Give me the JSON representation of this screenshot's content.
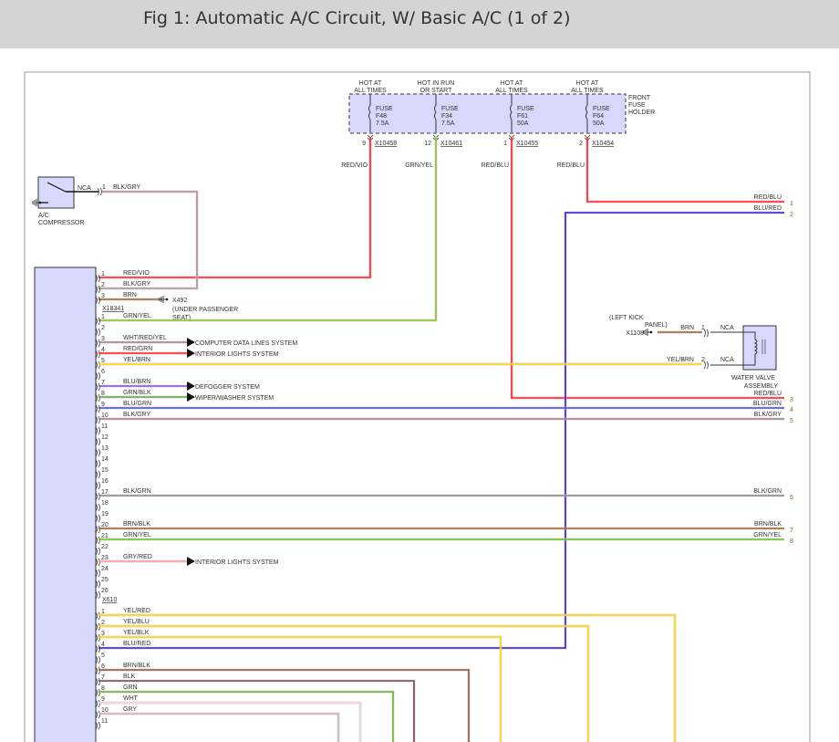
{
  "title": "Fig 1: Automatic A/C Circuit, W/ Basic A/C (1 of 2)",
  "fuse_holder": {
    "label": [
      "FRONT",
      "FUSE",
      "HOLDER"
    ],
    "fuses": [
      {
        "supply": [
          "HOT AT",
          "ALL TIMES"
        ],
        "name": "FUSE",
        "id": "F48",
        "rating": "7.5A",
        "pin": "9",
        "connector": "X10458",
        "wire": "RED/VIO"
      },
      {
        "supply": [
          "HOT IN RUN",
          "OR START"
        ],
        "name": "FUSE",
        "id": "F34",
        "rating": "7.5A",
        "pin": "12",
        "connector": "X10461",
        "wire": "GRN/YEL"
      },
      {
        "supply": [
          "HOT AT",
          "ALL TIMES"
        ],
        "name": "FUSE",
        "id": "F61",
        "rating": "50A",
        "pin": "1",
        "connector": "X10455",
        "wire": "RED/BLU"
      },
      {
        "supply": [
          "HOT AT",
          "ALL TIMES"
        ],
        "name": "FUSE",
        "id": "F64",
        "rating": "50A",
        "pin": "2",
        "connector": "X10454",
        "wire": "RED/BLU"
      }
    ]
  },
  "compressor": {
    "label": [
      "A/C",
      "COMPRESSOR"
    ],
    "nca": "NCA",
    "pin": "1",
    "wire": "BLK/GRY"
  },
  "ground_x492": {
    "id": "X492",
    "location": [
      "(UNDER PASSENGER",
      "SEAT)"
    ]
  },
  "connector_x18341": {
    "label": "X18341",
    "pins": [
      {
        "pin": "1",
        "wire": "RED/VIO",
        "color": "#ff2020"
      },
      {
        "pin": "2",
        "wire": "BLK/GRY",
        "color": "#9a9a9a"
      },
      {
        "pin": "3",
        "wire": "BRN",
        "color": "#8b6a2a"
      }
    ]
  },
  "connector_main": {
    "pins": [
      {
        "pin": "1",
        "wire": "GRN/YEL",
        "color": "#66cc33"
      },
      {
        "pin": "2",
        "wire": "",
        "color": ""
      },
      {
        "pin": "3",
        "wire": "WHT/RED/YEL",
        "color": "#8a8a8a",
        "dest": "COMPUTER DATA LINES SYSTEM"
      },
      {
        "pin": "4",
        "wire": "RED/GRN",
        "color": "#ff2020",
        "dest": "INTERIOR LIGHTS SYSTEM"
      },
      {
        "pin": "5",
        "wire": "YEL/BRN",
        "color": "#f0e000"
      },
      {
        "pin": "6",
        "wire": "",
        "color": ""
      },
      {
        "pin": "7",
        "wire": "BLU/BRN",
        "color": "#6b5bd6",
        "dest": "DEFOGGER SYSTEM"
      },
      {
        "pin": "8",
        "wire": "GRN/BLK",
        "color": "#55aa44",
        "dest": "WIPER/WASHER SYSTEM"
      },
      {
        "pin": "9",
        "wire": "BLU/GRN",
        "color": "#3355cc"
      },
      {
        "pin": "10",
        "wire": "BLK/GRY",
        "color": "#888888"
      },
      {
        "pin": "11",
        "wire": "",
        "color": ""
      },
      {
        "pin": "12",
        "wire": "",
        "color": ""
      },
      {
        "pin": "13",
        "wire": "",
        "color": ""
      },
      {
        "pin": "14",
        "wire": "",
        "color": ""
      },
      {
        "pin": "15",
        "wire": "",
        "color": ""
      },
      {
        "pin": "16",
        "wire": "",
        "color": ""
      },
      {
        "pin": "17",
        "wire": "BLK/GRN",
        "color": "#7f8f7f"
      },
      {
        "pin": "18",
        "wire": "",
        "color": ""
      },
      {
        "pin": "19",
        "wire": "",
        "color": ""
      },
      {
        "pin": "20",
        "wire": "BRN/BLK",
        "color": "#8b6a2a"
      },
      {
        "pin": "21",
        "wire": "GRN/YEL",
        "color": "#55cc22"
      },
      {
        "pin": "22",
        "wire": "",
        "color": ""
      },
      {
        "pin": "23",
        "wire": "GRY/RED",
        "color": "#f0a0a8",
        "dest": "INTERIOR LIGHTS SYSTEM"
      },
      {
        "pin": "24",
        "wire": "",
        "color": ""
      },
      {
        "pin": "25",
        "wire": "",
        "color": ""
      },
      {
        "pin": "26",
        "wire": "",
        "color": ""
      }
    ]
  },
  "connector_x610": {
    "label": "X610",
    "pins": [
      {
        "pin": "1",
        "wire": "YEL/RED",
        "color": "#f0e000"
      },
      {
        "pin": "2",
        "wire": "YEL/BLU",
        "color": "#f0e000"
      },
      {
        "pin": "3",
        "wire": "YEL/BLK",
        "color": "#f0e000"
      },
      {
        "pin": "4",
        "wire": "BLU/RED",
        "color": "#2020ee"
      },
      {
        "pin": "5",
        "wire": "",
        "color": ""
      },
      {
        "pin": "6",
        "wire": "BRN/BLK",
        "color": "#7a6030"
      },
      {
        "pin": "7",
        "wire": "BLK",
        "color": "#555555"
      },
      {
        "pin": "8",
        "wire": "GRN",
        "color": "#55bb33"
      },
      {
        "pin": "9",
        "wire": "WHT",
        "color": "#dddddd"
      },
      {
        "pin": "10",
        "wire": "GRY",
        "color": "#bbbbbb"
      },
      {
        "pin": "11",
        "wire": "",
        "color": ""
      }
    ]
  },
  "right_outputs": [
    {
      "num": "1",
      "wire": "RED/BLU"
    },
    {
      "num": "2",
      "wire": "BLU/RED"
    },
    {
      "num": "3",
      "wire": "RED/BLU"
    },
    {
      "num": "4",
      "wire": "BLU/GRN"
    },
    {
      "num": "5",
      "wire": "BLK/GRY"
    },
    {
      "num": "6",
      "wire": "BLK/GRN"
    },
    {
      "num": "7",
      "wire": "BRN/BLK"
    },
    {
      "num": "8",
      "wire": "GRN/YEL"
    }
  ],
  "water_valve": {
    "label": [
      "WATER VALVE",
      "ASSEMBLY"
    ],
    "ground": {
      "location": [
        "(LEFT KICK",
        "PANEL)"
      ],
      "id": "X1108"
    },
    "pins": [
      {
        "pin": "1",
        "wire": "BRN",
        "nca": "NCA"
      },
      {
        "pin": "2",
        "wire": "YEL/BRN",
        "nca": "NCA"
      }
    ]
  },
  "colors": {
    "module_fill": "#d8d8fc",
    "frame": "#999999",
    "title_bar": "#d4d4d4"
  }
}
